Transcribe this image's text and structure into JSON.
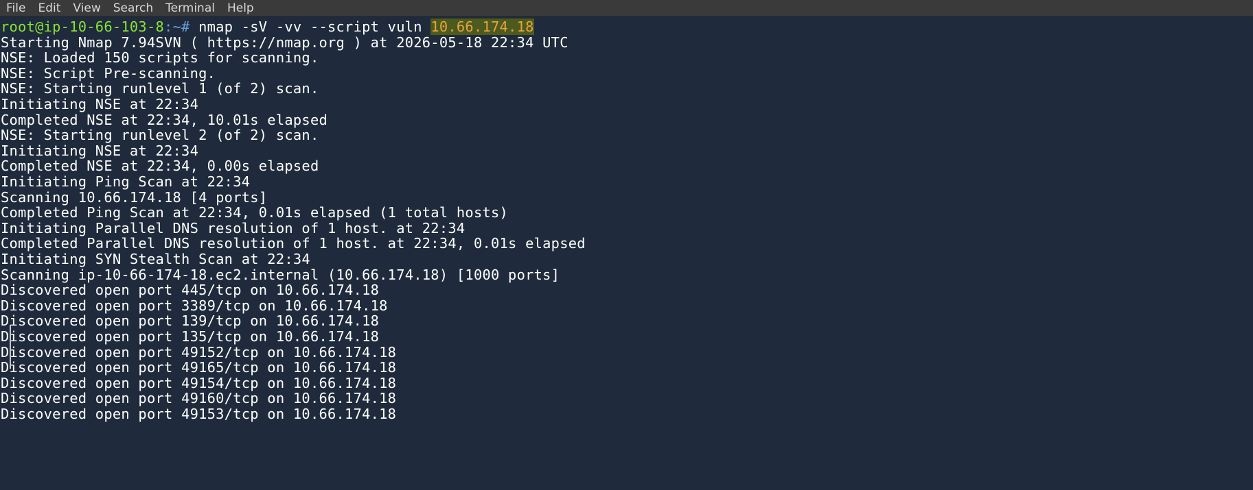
{
  "menubar": {
    "items": [
      "File",
      "Edit",
      "View",
      "Search",
      "Terminal",
      "Help"
    ]
  },
  "terminal": {
    "prompt": {
      "user_host": "root@ip-10-66-103-8",
      "path_suffix": ":~# ",
      "command": "nmap -sV -vv --script vuln ",
      "highlighted_target": "10.66.174.18"
    },
    "output_lines": [
      "Starting Nmap 7.94SVN ( https://nmap.org ) at 2026-05-18 22:34 UTC",
      "NSE: Loaded 150 scripts for scanning.",
      "NSE: Script Pre-scanning.",
      "NSE: Starting runlevel 1 (of 2) scan.",
      "Initiating NSE at 22:34",
      "Completed NSE at 22:34, 10.01s elapsed",
      "NSE: Starting runlevel 2 (of 2) scan.",
      "Initiating NSE at 22:34",
      "Completed NSE at 22:34, 0.00s elapsed",
      "Initiating Ping Scan at 22:34",
      "Scanning 10.66.174.18 [4 ports]",
      "Completed Ping Scan at 22:34, 0.01s elapsed (1 total hosts)",
      "Initiating Parallel DNS resolution of 1 host. at 22:34",
      "Completed Parallel DNS resolution of 1 host. at 22:34, 0.01s elapsed",
      "Initiating SYN Stealth Scan at 22:34",
      "Scanning ip-10-66-174-18.ec2.internal (10.66.174.18) [1000 ports]",
      "Discovered open port 445/tcp on 10.66.174.18",
      "Discovered open port 3389/tcp on 10.66.174.18",
      "Discovered open port 139/tcp on 10.66.174.18",
      "Discovered open port 135/tcp on 10.66.174.18",
      "Discovered open port 49152/tcp on 10.66.174.18",
      "Discovered open port 49165/tcp on 10.66.174.18",
      "Discovered open port 49154/tcp on 10.66.174.18",
      "Discovered open port 49160/tcp on 10.66.174.18",
      "Discovered open port 49153/tcp on 10.66.174.18"
    ]
  },
  "colors": {
    "background": "#1f2b3c",
    "prompt_user": "#8ae234",
    "prompt_path": "#6a9fd8",
    "highlight_text": "#e8a33a",
    "highlight_bg": "#4d5a1e"
  }
}
